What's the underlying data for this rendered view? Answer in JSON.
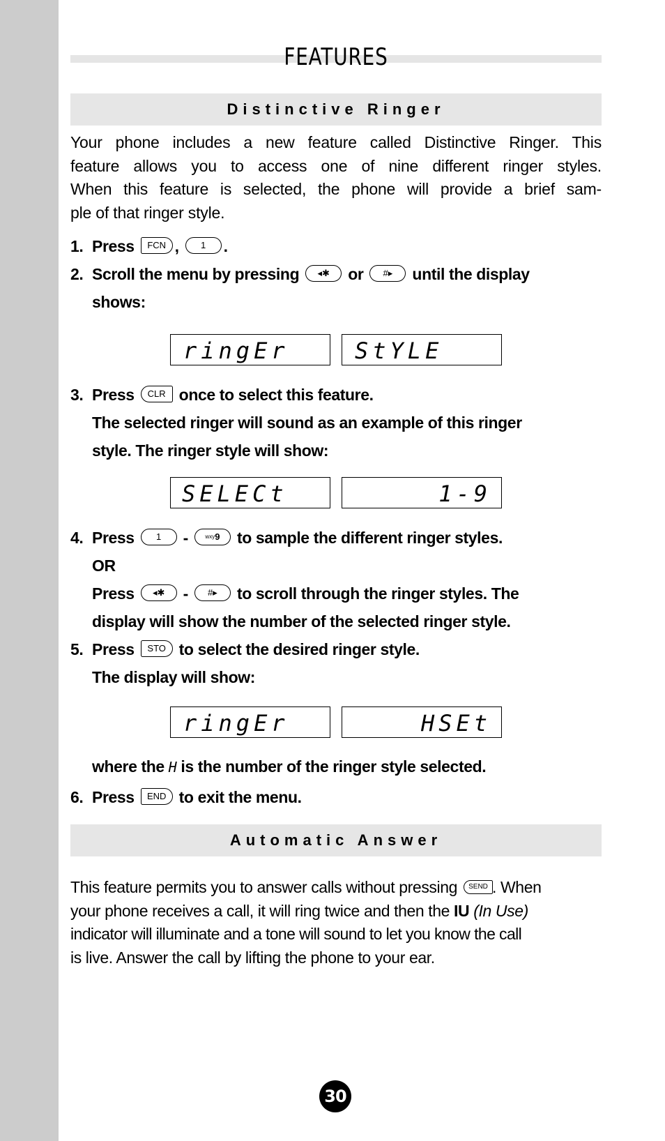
{
  "page": {
    "title": "FEATURES",
    "page_number": "30"
  },
  "distinctive_ringer": {
    "heading": "Distinctive Ringer",
    "intro_lines": [
      "Your phone includes a new feature called Distinctive Ringer. This",
      "feature allows you to access one of nine different ringer styles.",
      "When this feature is selected, the phone will provide a brief sam-",
      "ple of that ringer style."
    ],
    "steps": {
      "s1": {
        "num": "1.",
        "press": "Press",
        "key1": "FCN",
        "sep": ",",
        "key2": "1",
        "end": "."
      },
      "s2": {
        "num": "2.",
        "text_a": "Scroll the menu by pressing",
        "key1": "◂✱",
        "or": "or",
        "key2": "#▸",
        "text_b": "until the display",
        "text_c": "shows:"
      },
      "s2_display": {
        "left": "ringEr",
        "right": "StYLE"
      },
      "s3": {
        "num": "3.",
        "press": "Press",
        "key": "CLR",
        "text": "once to select this feature.",
        "line2": "The selected ringer will sound as an example of this ringer",
        "line3": "style. The ringer style will show:"
      },
      "s3_display": {
        "left": "SELECt",
        "right": "1-9"
      },
      "s4": {
        "num": "4.",
        "press": "Press",
        "key1": "1",
        "dash": "-",
        "key2": "9",
        "key2_sub": "wxy",
        "text": "to sample the different ringer styles.",
        "or": "OR",
        "press2": "Press",
        "key3": "◂✱",
        "dash2": "-",
        "key4": "#▸",
        "text2": "to scroll through the ringer styles. The",
        "text3": "display will show the number of the selected ringer style."
      },
      "s5": {
        "num": "5.",
        "press": "Press",
        "key": "STO",
        "text": "to select the desired ringer style.",
        "line2": "The display will show:"
      },
      "s5_display": {
        "left": "ringEr",
        "right": "HSEt"
      },
      "s5_note": {
        "a": "where the",
        "symbol": "H",
        "b": "is the number of the ringer style selected."
      },
      "s6": {
        "num": "6.",
        "press": "Press",
        "key": "END",
        "text": "to exit the menu."
      }
    }
  },
  "automatic_answer": {
    "heading": "Automatic Answer",
    "line1_a": "This feature permits you to answer calls without pressing",
    "line1_key": "SEND",
    "line1_b": ". When",
    "line2_a": "your phone receives a call, it will ring twice and then the",
    "line2_bold": "IU",
    "line2_italic": "(In Use)",
    "line3": "indicator will illuminate and a tone will sound to let you know the call",
    "line4": "is live. Answer the call by lifting the phone to your ear."
  }
}
